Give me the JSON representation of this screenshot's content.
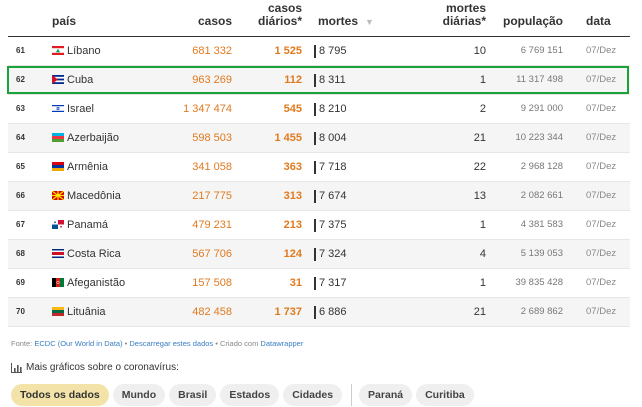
{
  "header": {
    "pais": "país",
    "casos": "casos",
    "casos_diarios_1": "casos",
    "casos_diarios_2": "diários*",
    "mortes": "mortes",
    "sort_icon": "▼",
    "mortes_diarias_1": "mortes",
    "mortes_diarias_2": "diárias*",
    "populacao": "população",
    "data": "data"
  },
  "rows": [
    {
      "rank": "61",
      "flag": "lebanon-flag",
      "name": "Líbano",
      "casos": "681 332",
      "casos_diarios": "1 525",
      "mortes": "8 795",
      "mortes_diarias": "10",
      "populacao": "6 769 151",
      "data": "07/Dez"
    },
    {
      "rank": "62",
      "flag": "cuba-flag",
      "name": "Cuba",
      "casos": "963 269",
      "casos_diarios": "112",
      "mortes": "8 311",
      "mortes_diarias": "1",
      "populacao": "11 317 498",
      "data": "07/Dez"
    },
    {
      "rank": "63",
      "flag": "israel-flag",
      "name": "Israel",
      "casos": "1 347 474",
      "casos_diarios": "545",
      "mortes": "8 210",
      "mortes_diarias": "2",
      "populacao": "9 291 000",
      "data": "07/Dez"
    },
    {
      "rank": "64",
      "flag": "azerbaijan-flag",
      "name": "Azerbaijão",
      "casos": "598 503",
      "casos_diarios": "1 455",
      "mortes": "8 004",
      "mortes_diarias": "21",
      "populacao": "10 223 344",
      "data": "07/Dez"
    },
    {
      "rank": "65",
      "flag": "armenia-flag",
      "name": "Armênia",
      "casos": "341 058",
      "casos_diarios": "363",
      "mortes": "7 718",
      "mortes_diarias": "22",
      "populacao": "2 968 128",
      "data": "07/Dez"
    },
    {
      "rank": "66",
      "flag": "macedonia-flag",
      "name": "Macedônia",
      "casos": "217 775",
      "casos_diarios": "313",
      "mortes": "7 674",
      "mortes_diarias": "13",
      "populacao": "2 082 661",
      "data": "07/Dez"
    },
    {
      "rank": "67",
      "flag": "panama-flag",
      "name": "Panamá",
      "casos": "479 231",
      "casos_diarios": "213",
      "mortes": "7 375",
      "mortes_diarias": "1",
      "populacao": "4 381 583",
      "data": "07/Dez"
    },
    {
      "rank": "68",
      "flag": "costa-rica-flag",
      "name": "Costa Rica",
      "casos": "567 706",
      "casos_diarios": "124",
      "mortes": "7 324",
      "mortes_diarias": "4",
      "populacao": "5 139 053",
      "data": "07/Dez"
    },
    {
      "rank": "69",
      "flag": "afghanistan-flag",
      "name": "Afeganistão",
      "casos": "157 508",
      "casos_diarios": "31",
      "mortes": "7 317",
      "mortes_diarias": "1",
      "populacao": "39 835 428",
      "data": "07/Dez"
    },
    {
      "rank": "70",
      "flag": "lithuania-flag",
      "name": "Lituânia",
      "casos": "482 458",
      "casos_diarios": "1 737",
      "mortes": "6 886",
      "mortes_diarias": "21",
      "populacao": "2 689 862",
      "data": "07/Dez"
    }
  ],
  "source": {
    "prefix": "Fonte: ",
    "link1": "ECDC (Our World in Data)",
    "sep1": " • ",
    "link2": "Descarregar estes dados",
    "sep2": " • Criado com ",
    "link3": "Datawrapper"
  },
  "more": {
    "icon": "bar-chart-icon",
    "label": "Mais gráficos sobre o coronavírus:"
  },
  "chips": [
    "Todos os dados",
    "Mundo",
    "Brasil",
    "Estados",
    "Cidades"
  ],
  "chips_after": [
    "Paraná",
    "Curitiba"
  ],
  "colors": {
    "accent_orange": "#e07a1f",
    "highlight_green": "#1aa33a",
    "chip_active": "#f3e3a8"
  }
}
